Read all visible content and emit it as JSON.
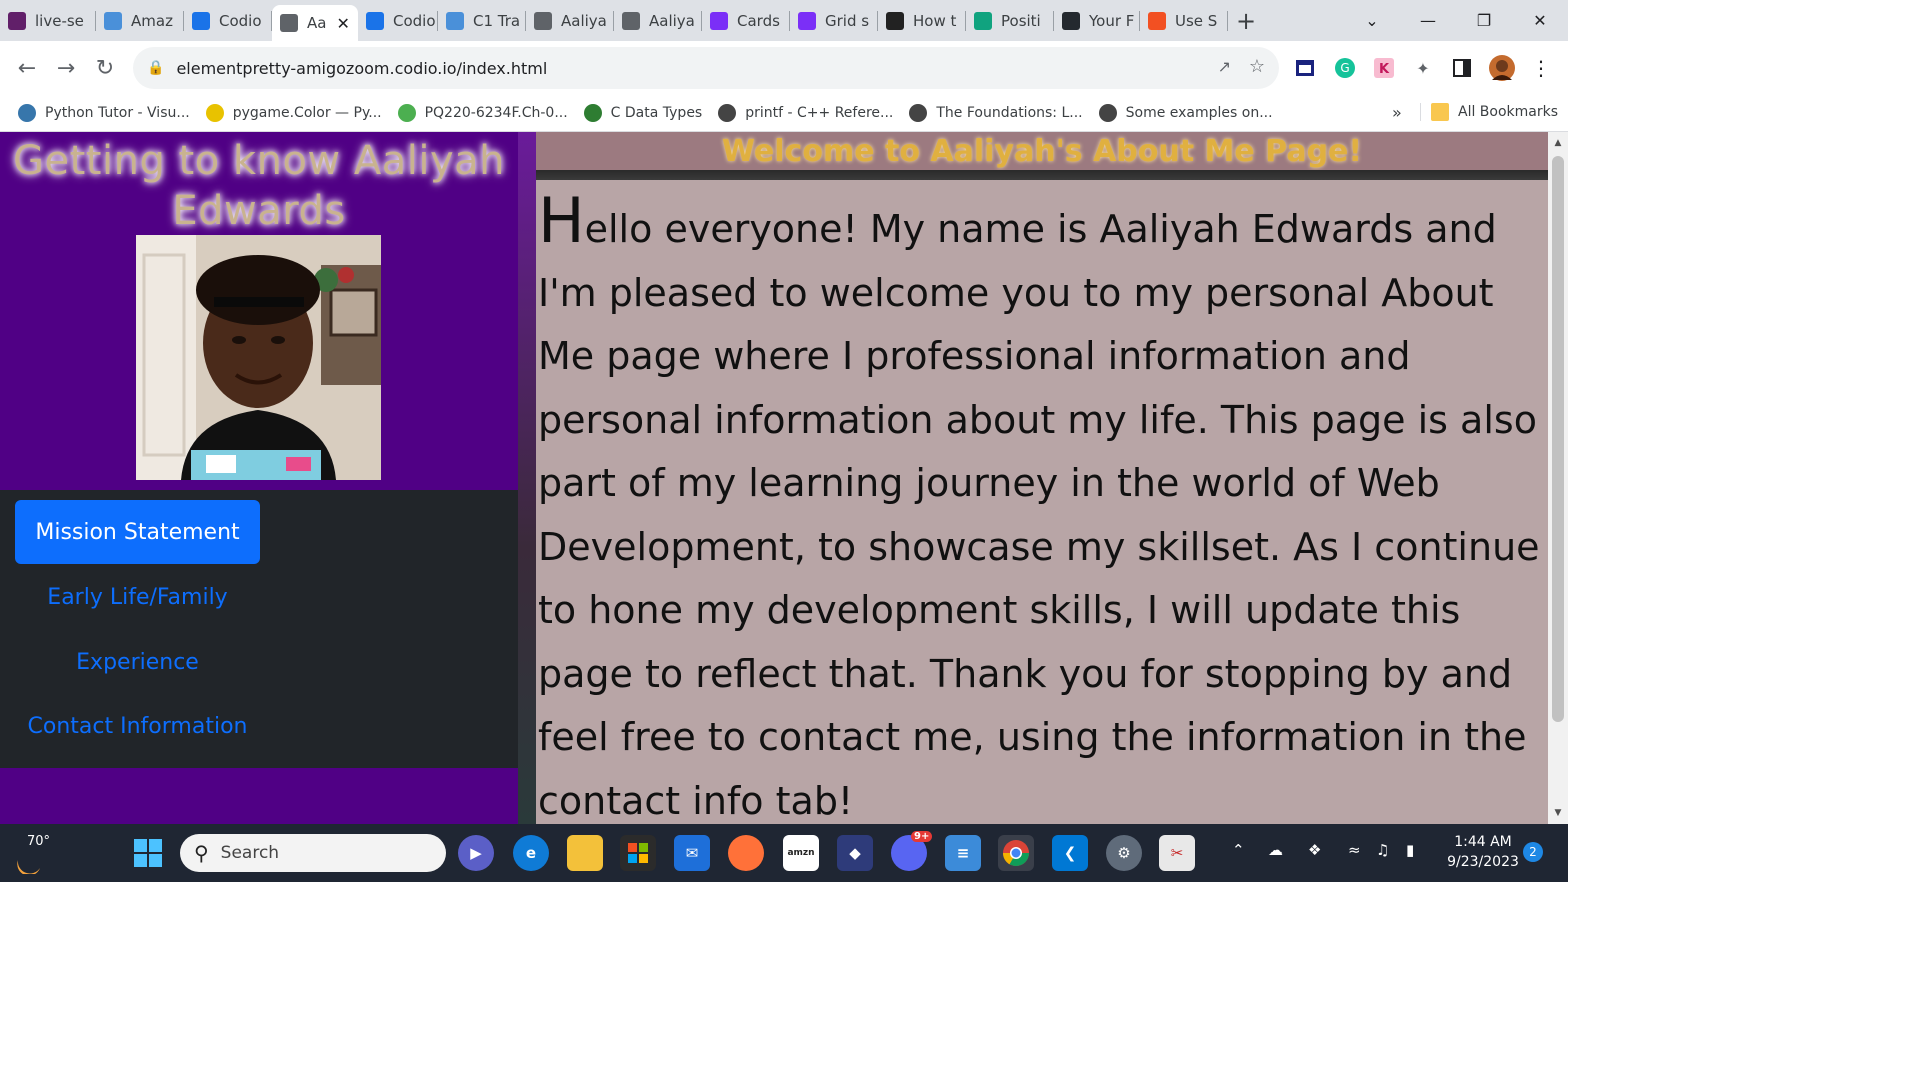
{
  "browser": {
    "tabs": [
      {
        "label": "live-se",
        "icon": "slack-icon",
        "color": "#611f69"
      },
      {
        "label": "Amaz",
        "icon": "dots-icon",
        "color": "#4a90d9"
      },
      {
        "label": "Codio",
        "icon": "codio-icon",
        "color": "#1a73e8"
      },
      {
        "label": "Aa",
        "icon": "globe-icon",
        "color": "#5f6368",
        "active": true
      },
      {
        "label": "Codio",
        "icon": "codio-icon",
        "color": "#1a73e8"
      },
      {
        "label": "C1 Tra",
        "icon": "dots-icon",
        "color": "#4a90d9"
      },
      {
        "label": "Aaliya",
        "icon": "globe-icon",
        "color": "#5f6368"
      },
      {
        "label": "Aaliya",
        "icon": "globe-icon",
        "color": "#5f6368"
      },
      {
        "label": "Cards",
        "icon": "bootstrap-icon",
        "color": "#7b2ff7"
      },
      {
        "label": "Grid s",
        "icon": "bootstrap-icon",
        "color": "#7b2ff7"
      },
      {
        "label": "How t",
        "icon": "code-icon",
        "color": "#222222"
      },
      {
        "label": "Positi",
        "icon": "chatgpt-icon",
        "color": "#10a37f"
      },
      {
        "label": "Your F",
        "icon": "github-icon",
        "color": "#24292f"
      },
      {
        "label": "Use S",
        "icon": "microsoft-icon",
        "color": "#f25022"
      }
    ],
    "url": "elementpretty-amigozoom.codio.io/index.html",
    "bookmarks": [
      {
        "label": "Python Tutor - Visu...",
        "color": "#3776ab"
      },
      {
        "label": "pygame.Color — Py...",
        "color": "#e8c200"
      },
      {
        "label": "PQ220-6234F.Ch-0...",
        "color": "#4caf50"
      },
      {
        "label": "C Data Types",
        "color": "#2e7d32"
      },
      {
        "label": "printf - C++ Refere...",
        "color": "#444444"
      },
      {
        "label": "The Foundations: L...",
        "color": "#444444"
      },
      {
        "label": "Some examples on...",
        "color": "#444444"
      }
    ],
    "bookmarks_overflow": "»",
    "all_bookmarks": "All Bookmarks"
  },
  "page": {
    "site_title": "Getting to know Aaliyah Edwards",
    "welcome": "Welcome to Aaliyah's About Me Page!",
    "nav": [
      {
        "label": "Mission Statement",
        "active": true
      },
      {
        "label": "Early Life/Family",
        "active": false
      },
      {
        "label": "Experience",
        "active": false
      },
      {
        "label": "Contact Information",
        "active": false
      }
    ],
    "intro_dropcap": "H",
    "intro_rest": "ello everyone! My name is Aaliyah Edwards and I'm pleased to welcome you to my personal About Me page where I professional information and personal information about my life. This page is also part of my learning journey in the world of Web Development, to showcase my skillset. As I continue to hone my development skills, I will update this page to reflect that. Thank you for stopping by and feel free to contact me, using the information in the contact info tab!"
  },
  "taskbar": {
    "weather": "70°",
    "search_placeholder": "Search",
    "time": "1:44 AM",
    "date": "9/23/2023",
    "notifications": "2",
    "discord_badge": "9+"
  }
}
